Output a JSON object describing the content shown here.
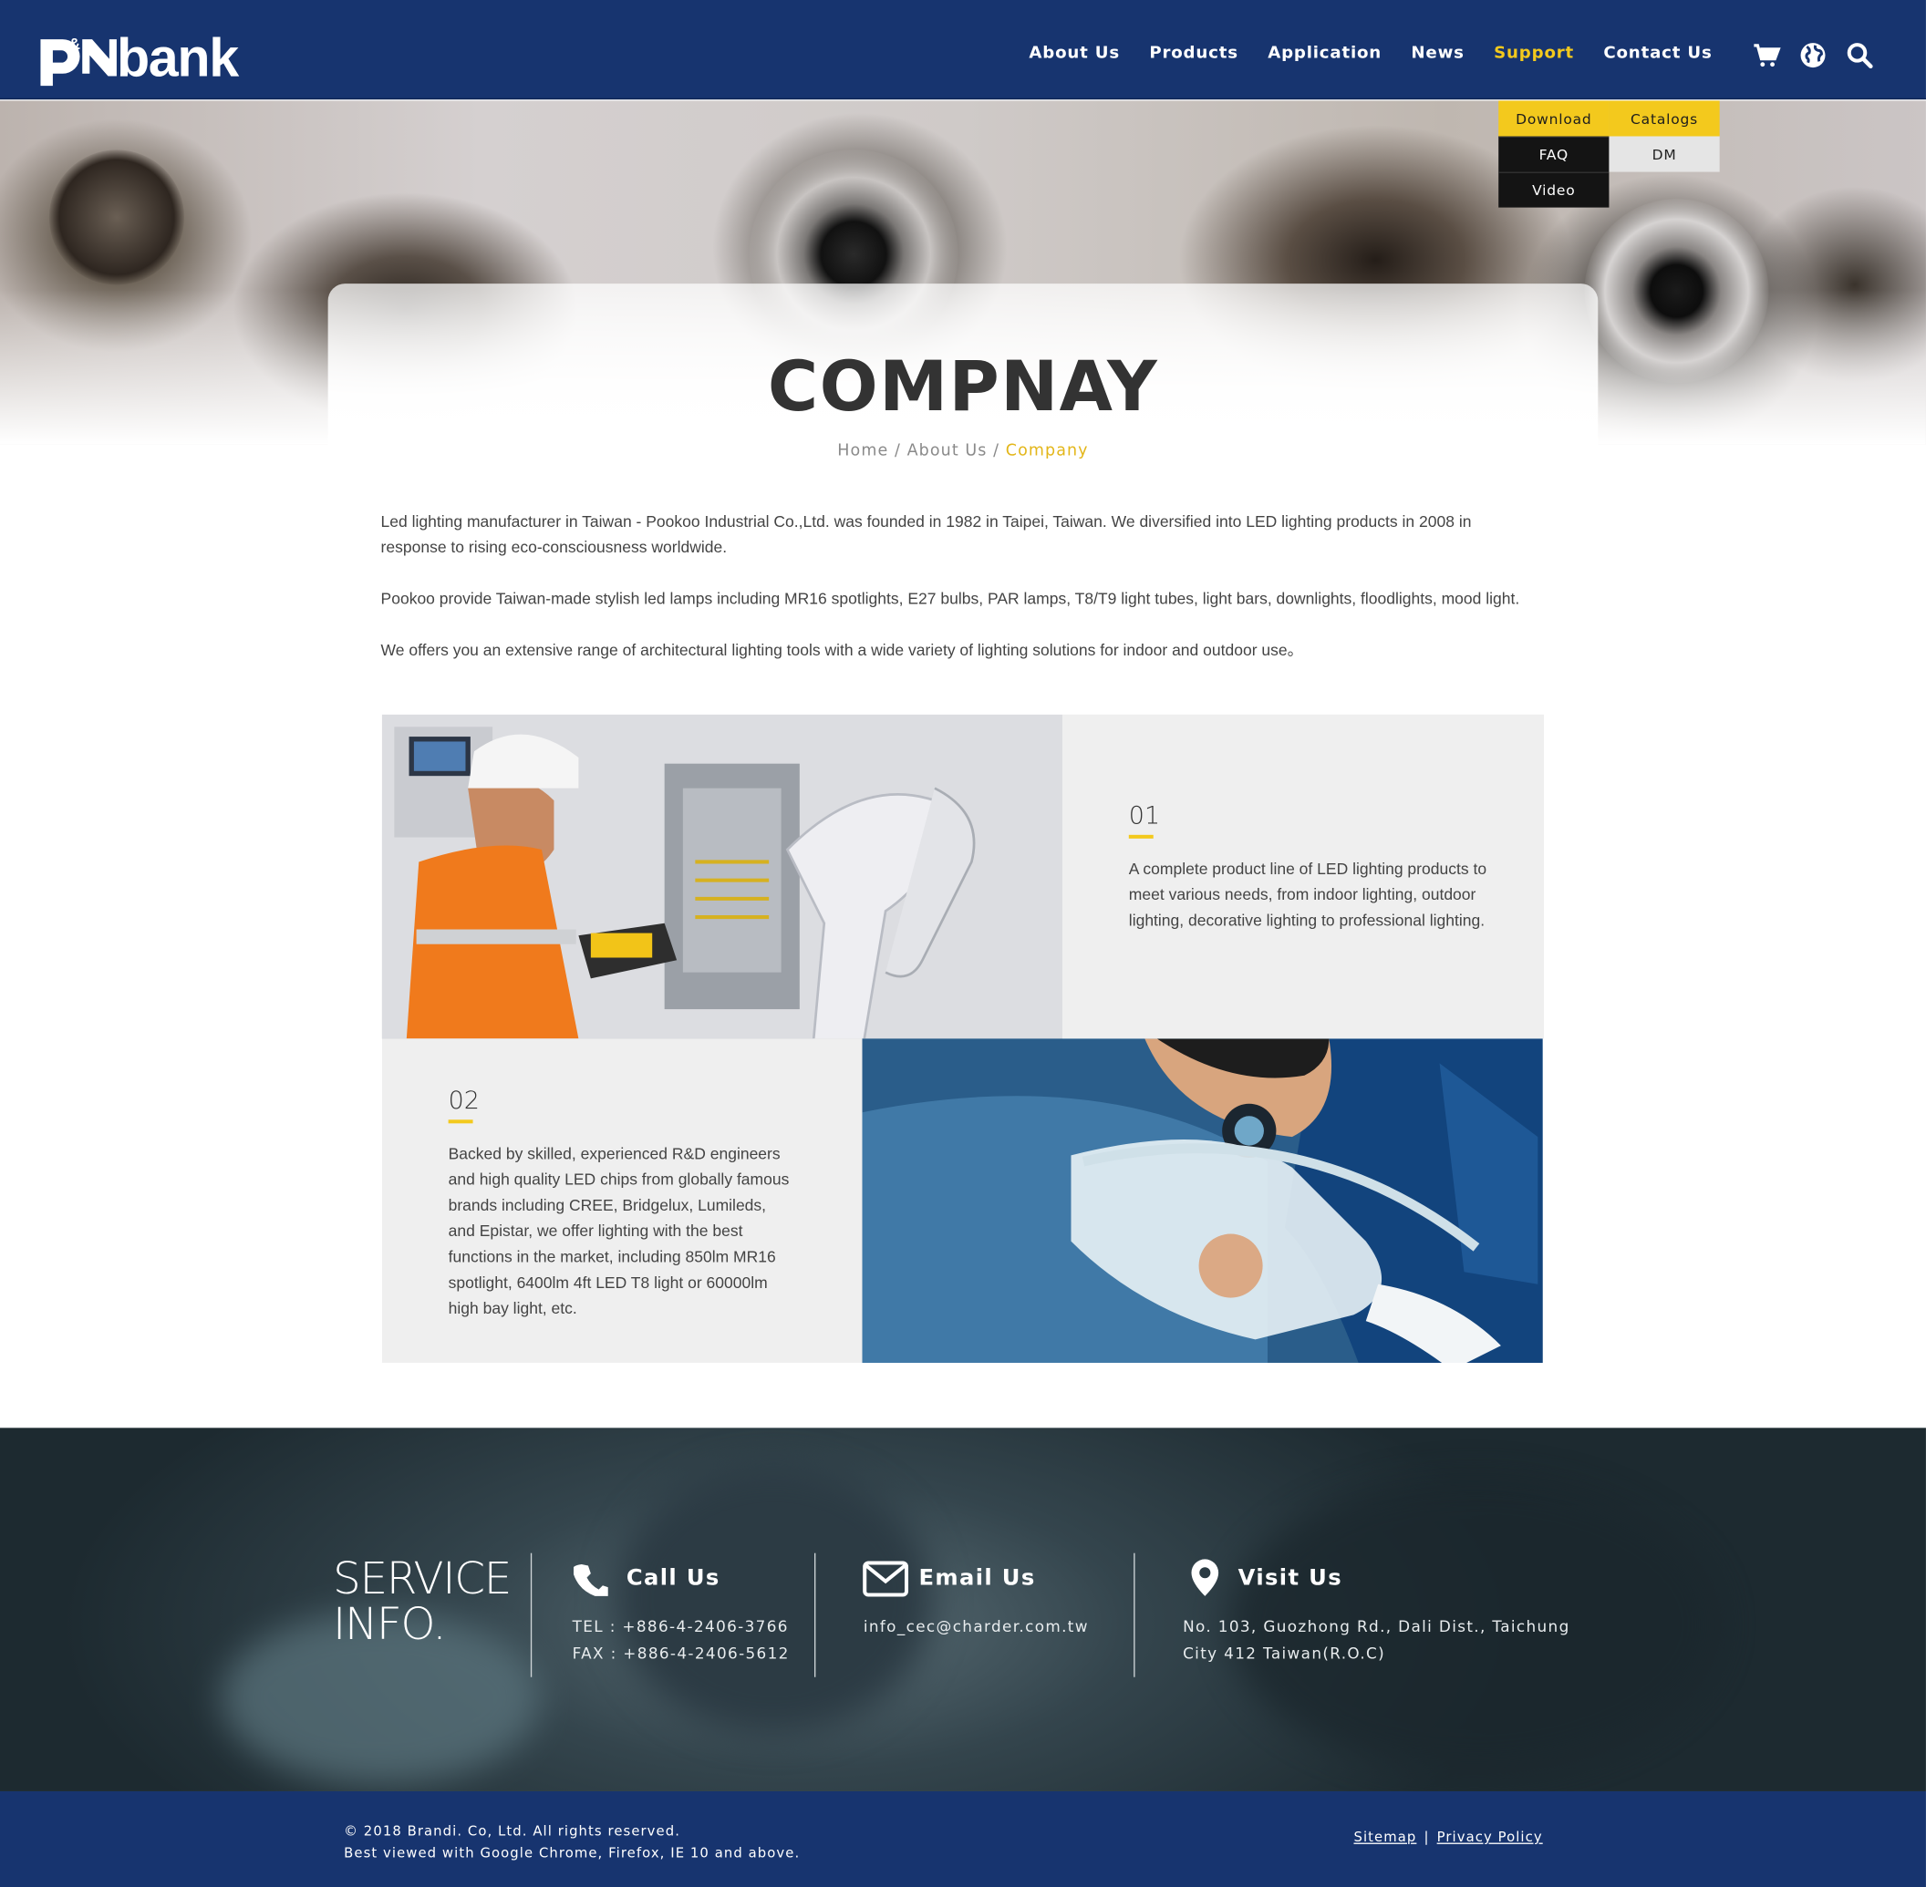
{
  "brand": {
    "logo_text": "bank",
    "logo_mark_text": "p&n"
  },
  "nav": {
    "items": [
      {
        "label": "About Us"
      },
      {
        "label": "Products"
      },
      {
        "label": "Application"
      },
      {
        "label": "News"
      },
      {
        "label": "Support"
      },
      {
        "label": "Contact Us"
      }
    ],
    "active": "Support",
    "icons": [
      "cart-icon",
      "globe-icon",
      "search-icon"
    ]
  },
  "support_menu": {
    "items": [
      "Download",
      "Catalogs",
      "FAQ",
      "DM",
      "Video"
    ]
  },
  "page": {
    "title": "COMPNAY",
    "breadcrumb": {
      "home": "Home",
      "sep": " / ",
      "parent": "About Us",
      "current": "Company"
    },
    "intro": [
      "Led lighting manufacturer in Taiwan - Pookoo Industrial Co.,Ltd. was founded in 1982 in Taipei, Taiwan. We diversified into LED lighting products in 2008 in response to rising eco-consciousness worldwide.",
      "Pookoo provide Taiwan-made stylish led lamps including MR16 spotlights, E27 bulbs, PAR lamps, T8/T9 light tubes, light bars, downlights, floodlights, mood light.",
      "We offers you an extensive range of architectural lighting tools with a wide variety of lighting solutions for indoor and outdoor use。"
    ]
  },
  "features": [
    {
      "number": "01",
      "text": "A complete product line of LED lighting products to meet various needs, from indoor lighting, outdoor lighting, decorative lighting to professional lighting."
    },
    {
      "number": "02",
      "text": "Backed by skilled, experienced R&D engineers and high quality LED chips from globally famous brands including CREE, Bridgelux, Lumileds, and Epistar, we offer lighting with the best functions in the market, including 850lm MR16 spotlight, 6400lm 4ft LED T8 light or 60000lm high bay light, etc."
    }
  ],
  "footer": {
    "service_line1": "SERVICE",
    "service_line2": "INFO.",
    "call": {
      "title": "Call Us",
      "tel": "TEL : +886-4-2406-3766",
      "fax": "FAX : +886-4-2406-5612"
    },
    "email": {
      "title": "Email Us",
      "address": "info_cec@charder.com.tw"
    },
    "visit": {
      "title": "Visit Us",
      "line1": "No. 103, Guozhong Rd., Dali Dist., Taichung",
      "line2": "City 412 Taiwan(R.O.C)"
    },
    "copyright": "© 2018 Brandi. Co, Ltd. All rights reserved.",
    "browser_note": "Best viewed with Google Chrome, Firefox, IE 10 and above.",
    "links": {
      "sitemap": "Sitemap",
      "separator": "|",
      "privacy": "Privacy Policy"
    }
  },
  "colors": {
    "navy": "#17346f",
    "accent_yellow": "#f3c91d",
    "panel_grey": "#efefef"
  }
}
